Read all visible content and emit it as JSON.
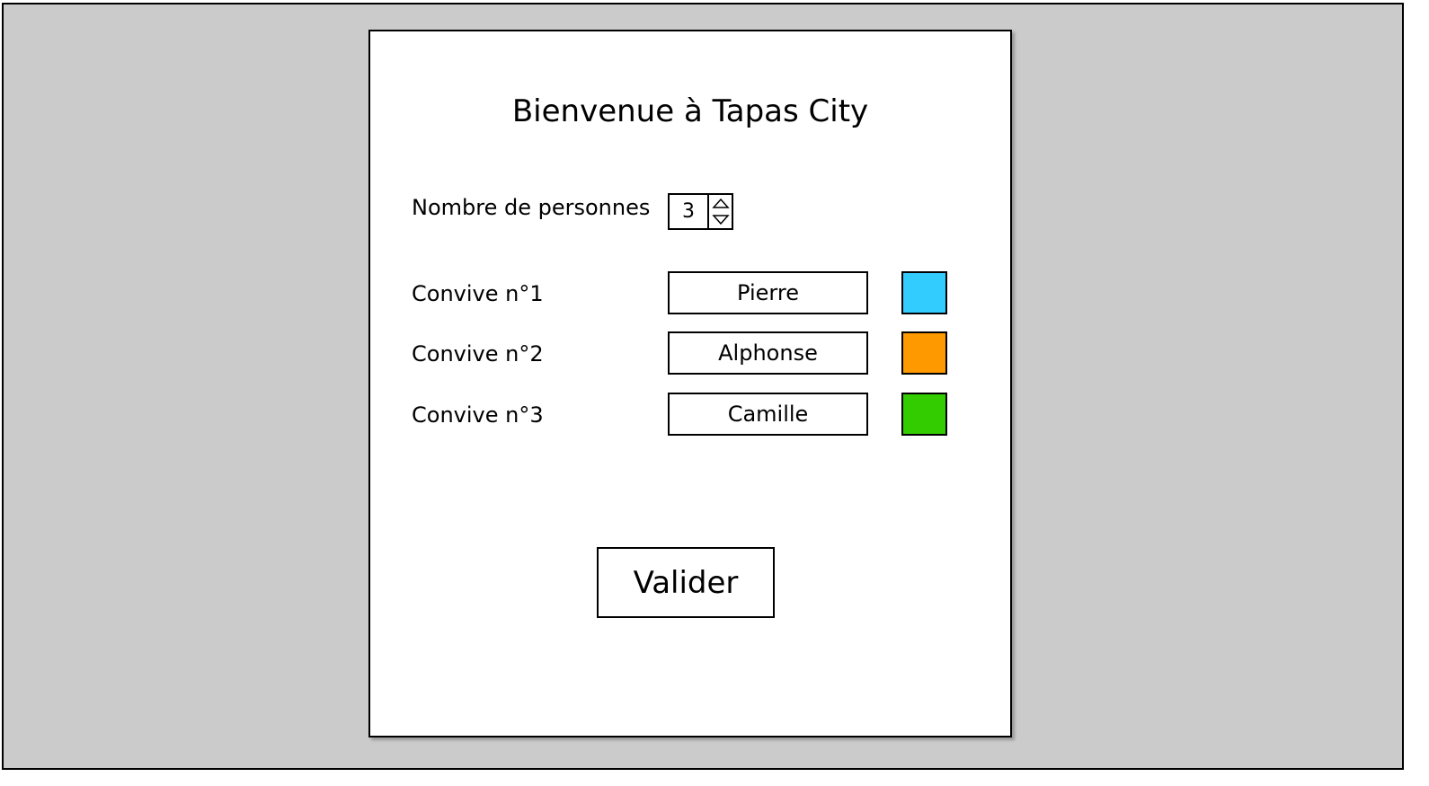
{
  "title": "Bienvenue à Tapas City",
  "person_count": {
    "label": "Nombre de personnes",
    "value": "3"
  },
  "guests": [
    {
      "label": "Convive n°1",
      "name": "Pierre",
      "color": "#33CCFF"
    },
    {
      "label": "Convive n°2",
      "name": "Alphonse",
      "color": "#FF9900"
    },
    {
      "label": "Convive n°3",
      "name": "Camille",
      "color": "#33CC00"
    }
  ],
  "submit_label": "Valider"
}
